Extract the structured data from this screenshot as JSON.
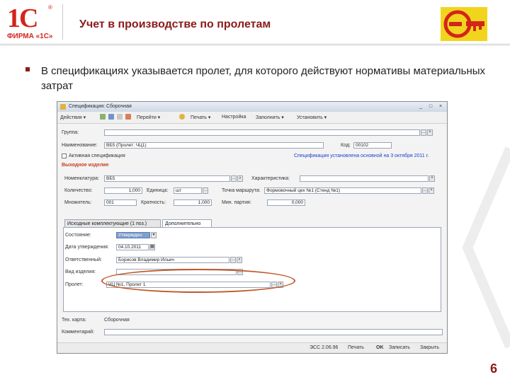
{
  "slide": {
    "logo_big": "1С",
    "logo_reg": "®",
    "logo_firm": "ФИРМА «1С»",
    "title": "Учет в производстве по пролетам",
    "bullet": "В спецификациях указывается пролет, для которого действуют нормативы материальных затрат",
    "page_number": "6",
    "accent_color": "#8b1a1a"
  },
  "window": {
    "title": "Спецификация: Сборочная",
    "window_buttons": [
      "_",
      "□",
      "×"
    ],
    "toolbar": {
      "actions_label": "Действия ▾",
      "goto_label": "Перейти ▾",
      "print_label": "Печать ▾",
      "settings_label": "Настройка",
      "fill_label": "Заполнить ▾",
      "more_label": "Установить ▾"
    },
    "fields": {
      "group_label": "Группа:",
      "name_label": "Наименование:",
      "name_value": "ВБ5 (Пролет: ЧЦ1)",
      "code_label": "Код:",
      "code_value": "00102",
      "active_label": "Активная спецификация",
      "status_link": "Спецификация установлена основной на 3 октября 2011 г.",
      "output_group": "Выходное изделие",
      "nomenclature_label": "Номенклатура:",
      "nomenclature_value": "ВБ5",
      "characteristic_label": "Характеристика:",
      "quantity_label": "Количество:",
      "quantity_value": "1,000",
      "unit_label": "Единица:",
      "unit_value": "шт",
      "route_label": "Точка маршрута:",
      "route_value": "Формовочный цех №1 (Стенд №1)",
      "multiplicity_label": "Множитель:",
      "multiplicity_value": "001",
      "kratnost_label": "Кратность:",
      "kratnost_value": "1,000",
      "min_label": "Мин. партия:",
      "min_value": "0,000"
    },
    "tabs": [
      "Исходные комплектующие (1 поз.)",
      "Дополнительно"
    ],
    "active_tab": 1,
    "extra": {
      "state_label": "Состояние:",
      "state_value": "Утвержден",
      "date_label": "Дата утверждения:",
      "date_value": "04.10.2011",
      "responsible_label": "Ответственный:",
      "responsible_value": "Борисов Владимир Ильич",
      "type_label": "Вид изделия:",
      "span_label": "Пролет:",
      "span_value": "ЧЦ №1, Пролет 1"
    },
    "tech_label": "Тех. карта:",
    "tech_value": "Сборочная",
    "comment_label": "Комментарий:",
    "footer": {
      "doc_label": "ЭСС 2.06.96",
      "print_button": "Печать",
      "record_button": "Записать",
      "ok_button": "OK",
      "close_button": "Закрыть"
    }
  }
}
